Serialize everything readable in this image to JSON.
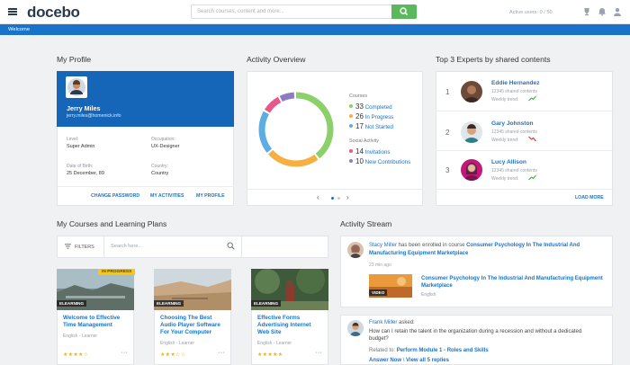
{
  "header": {
    "logo": "docebo",
    "search_placeholder": "Search courses, content and more...",
    "active_users": "Active users: 0 / 50"
  },
  "banner": {
    "title": "Welcome"
  },
  "profile": {
    "section_title": "My Profile",
    "name": "Jerry Miles",
    "email": "jerry.miles@homenick.info",
    "fields": [
      {
        "label": "Level:",
        "value": "Super Admin"
      },
      {
        "label": "Occupation:",
        "value": "UX-Designer"
      },
      {
        "label": "Date of Birth:",
        "value": "25 December, 89"
      },
      {
        "label": "Country:",
        "value": "Country"
      }
    ],
    "links": [
      "CHANGE PASSWORD",
      "MY ACTIVITIES",
      "MY PROFILE"
    ]
  },
  "activity": {
    "section_title": "Activity Overview",
    "courses_title": "Courses",
    "courses": [
      {
        "count": "33",
        "label": "Completed",
        "color": "#8cd06a"
      },
      {
        "count": "26",
        "label": "In Progress",
        "color": "#f5b041"
      },
      {
        "count": "17",
        "label": "Not Started",
        "color": "#5dade2"
      }
    ],
    "social_title": "Social Activity",
    "social": [
      {
        "count": "14",
        "label": "Invitations",
        "color": "#e8578a"
      },
      {
        "count": "10",
        "label": "New Contributions",
        "color": "#8e7cc3"
      }
    ]
  },
  "experts": {
    "section_title": "Top 3 Experts by shared contents",
    "list": [
      {
        "rank": "1",
        "name": "Eddie Hernandez",
        "shared": "12345 shared contents",
        "trend_label": "Weekly trend:",
        "trend": "up"
      },
      {
        "rank": "2",
        "name": "Gary Johnston",
        "shared": "12345 shared contents",
        "trend_label": "Weekly trend:",
        "trend": "down"
      },
      {
        "rank": "3",
        "name": "Lucy Allison",
        "shared": "12345 shared contents",
        "trend_label": "Weekly trend:",
        "trend": "up"
      }
    ],
    "load_more": "LOAD MORE"
  },
  "courses": {
    "section_title": "My Courses and Learning Plans",
    "filters": "FILTERS",
    "search_placeholder": "Search here..",
    "items": [
      {
        "badge": "IN PROGRESS",
        "type": "ELEARNING",
        "title": "Welcome to Effective Time Management",
        "meta": "English - Learner",
        "stars": "★★★★☆"
      },
      {
        "badge": "",
        "type": "ELEARNING",
        "title": "Choosing The Best Audio Player Software For Your Computer",
        "meta": "English - Learner",
        "stars": "★★★☆☆"
      },
      {
        "badge": "",
        "type": "ELEARNING",
        "title": "Effective Forms Advertising Internet Web Site",
        "meta": "English - Learner",
        "stars": "★★★★★"
      }
    ]
  },
  "stream": {
    "section_title": "Activity Stream",
    "item1": {
      "user": "Stacy Miller",
      "action": "has been enrolled in course",
      "course": "Consumer Psychology In The Industrial And Manufacturing Equipment Marketplace",
      "time": "23 min ago",
      "attachment_title": "Consumer Psychology In The Industrial And Manufacturing Equipment Marketplace",
      "attachment_lang": "English",
      "attachment_tag": "VIDEO"
    },
    "item2": {
      "user": "Frank Miller",
      "action": "asked:",
      "question": "How can I retain the talent in the organization during a recession and without a dedicated budget?",
      "related_label": "Related to:",
      "related": "Perform Module 1 - Roles and Skills",
      "answer": "Answer Now",
      "view": "View all 5 replies"
    }
  }
}
